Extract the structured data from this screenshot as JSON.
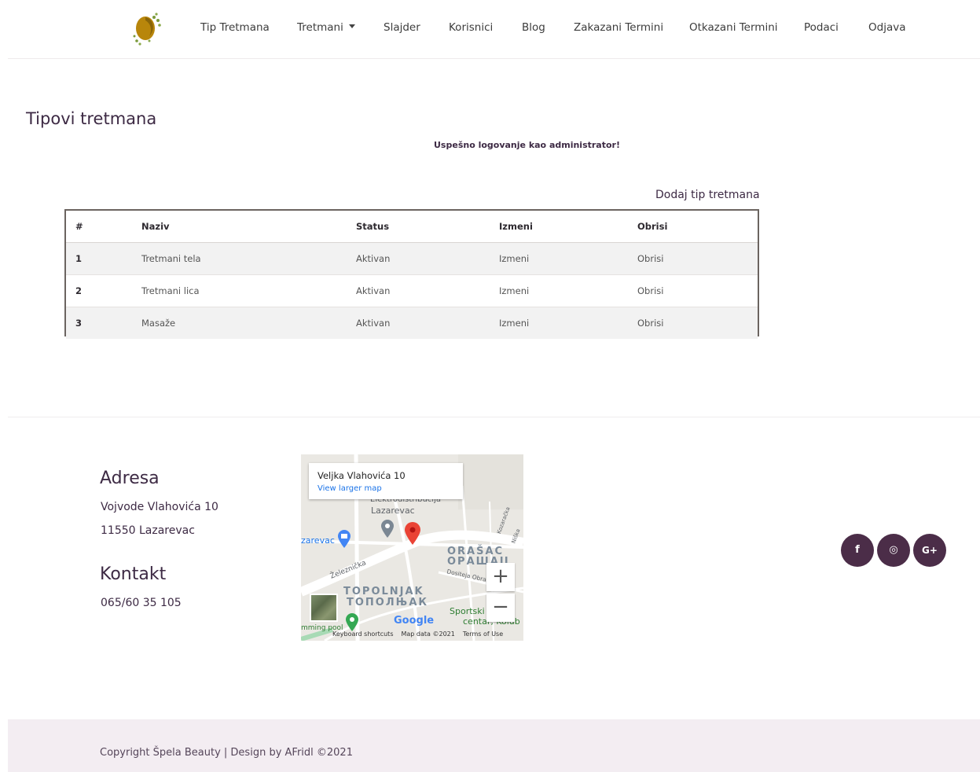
{
  "nav": {
    "items": [
      {
        "label": "Tip Tretmana"
      },
      {
        "label": "Tretmani"
      },
      {
        "label": "Slajder"
      },
      {
        "label": "Korisnici"
      },
      {
        "label": "Blog"
      },
      {
        "label": "Zakazani Termini"
      },
      {
        "label": "Otkazani Termini"
      },
      {
        "label": "Podaci"
      },
      {
        "label": "Odjava"
      }
    ]
  },
  "main": {
    "title": "Tipovi tretmana",
    "flash_message": "Uspešno logovanje kao administrator!",
    "add_link": "Dodaj tip tretmana",
    "table": {
      "headers": [
        "#",
        "Naziv",
        "Status",
        "Izmeni",
        "Obrisi"
      ],
      "rows": [
        {
          "num": "1",
          "name": "Tretmani tela",
          "status": "Aktivan",
          "edit": "Izmeni",
          "delete": "Obrisi"
        },
        {
          "num": "2",
          "name": "Tretmani lica",
          "status": "Aktivan",
          "edit": "Izmeni",
          "delete": "Obrisi"
        },
        {
          "num": "3",
          "name": "Masaže",
          "status": "Aktivan",
          "edit": "Izmeni",
          "delete": "Obrisi"
        }
      ]
    }
  },
  "footer": {
    "address_heading": "Adresa",
    "address_line1": "Vojvode Vlahovića 10",
    "address_line2": "11550 Lazarevac",
    "contact_heading": "Kontakt",
    "phone": "065/60 35 105",
    "map": {
      "place_title": "Veljka Vlahovića 10",
      "larger_map_link": "View larger map",
      "labels": {
        "elektro": "Elektrodistribucija",
        "lazarevac": "Lazarevac",
        "zarevac": "zarevac",
        "orasac": "ORAŠAC",
        "orasac_cyr": "ОРАШАЦ",
        "zeleznicka": "Železnička",
        "dositeja": "Dositeja Obrad",
        "kozaracka": "Kozaračka",
        "niska": "Niška",
        "topolnjak": "TOPOLNJAK",
        "topolnjak_cyr": "ТОПОЛЊАК",
        "sportski": "Sportski",
        "centar": "centar, Kolub",
        "swimming": "mming pool"
      },
      "google": "Google",
      "footer_links": [
        "Keyboard shortcuts",
        "Map data ©2021",
        "Terms of Use"
      ],
      "zoom_in": "+",
      "zoom_out": "−"
    },
    "social": [
      {
        "icon": "facebook-icon",
        "glyph": "f"
      },
      {
        "icon": "instagram-icon",
        "glyph": "◎"
      },
      {
        "icon": "google-plus-icon",
        "glyph": "G+"
      }
    ],
    "copyright": "Copyright Špela Beauty | Design by AFridl ©2021"
  },
  "colors": {
    "primary": "#3d2a44",
    "social_bg": "#4b2d48",
    "footer_bar": "#f3edf2",
    "logo_gold": "#b8860b"
  }
}
